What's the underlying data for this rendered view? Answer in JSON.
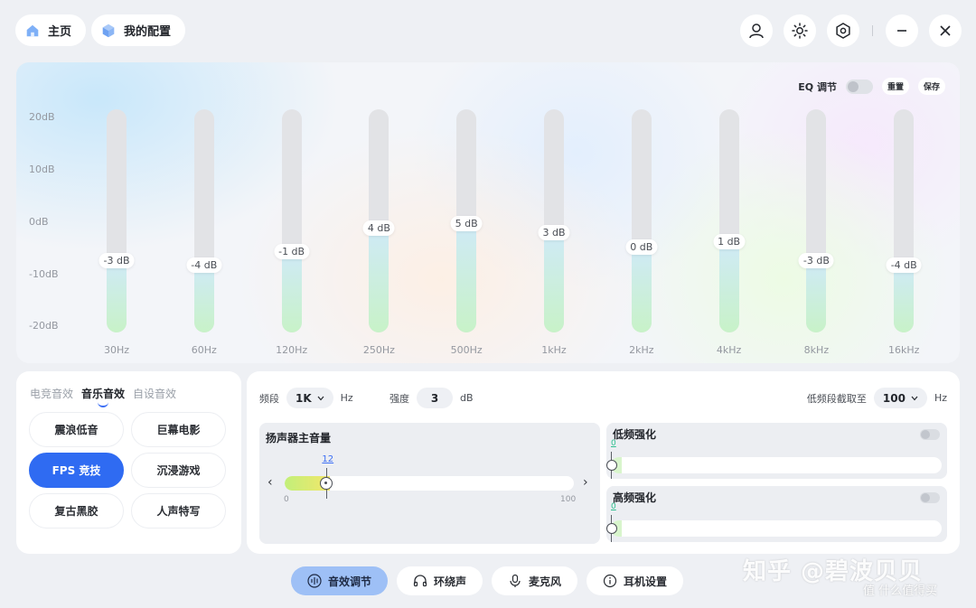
{
  "nav": {
    "home_label": "主页",
    "config_label": "我的配置"
  },
  "top_actions": [
    "user-icon",
    "brightness-icon",
    "settings-icon",
    "minimize-icon",
    "close-icon"
  ],
  "eq": {
    "toggle_label": "EQ 调节",
    "enabled": false,
    "reset_label": "重置",
    "save_label": "保存",
    "y_ticks": [
      "20dB",
      "10dB",
      "0dB",
      "-10dB",
      "-20dB"
    ],
    "range": [
      -20,
      20
    ],
    "bands": [
      {
        "freq": "30Hz",
        "gain": -3,
        "gain_label": "-3 dB"
      },
      {
        "freq": "60Hz",
        "gain": -4,
        "gain_label": "-4 dB"
      },
      {
        "freq": "120Hz",
        "gain": -1,
        "gain_label": "-1 dB"
      },
      {
        "freq": "250Hz",
        "gain": 4,
        "gain_label": "4 dB"
      },
      {
        "freq": "500Hz",
        "gain": 5,
        "gain_label": "5 dB"
      },
      {
        "freq": "1kHz",
        "gain": 3,
        "gain_label": "3 dB"
      },
      {
        "freq": "2kHz",
        "gain": 0,
        "gain_label": "0 dB"
      },
      {
        "freq": "4kHz",
        "gain": 1,
        "gain_label": "1 dB"
      },
      {
        "freq": "8kHz",
        "gain": -3,
        "gain_label": "-3 dB"
      },
      {
        "freq": "16kHz",
        "gain": -4,
        "gain_label": "-4 dB"
      }
    ]
  },
  "presets": {
    "tabs": [
      "电竞音效",
      "音乐音效",
      "自设音效"
    ],
    "active_tab": 1,
    "items": [
      "震浪低音",
      "巨幕电影",
      "FPS 竞技",
      "沉浸游戏",
      "复古黑胶",
      "人声特写"
    ],
    "selected": 2
  },
  "controls": {
    "band_label": "频段",
    "band_value": "1K",
    "band_unit": "Hz",
    "strength_label": "强度",
    "strength_value": "3",
    "strength_unit": "dB",
    "lowcut_label": "低频段截取至",
    "lowcut_value": "100",
    "lowcut_unit": "Hz",
    "volume": {
      "title": "扬声器主音量",
      "value": 12,
      "value_label": "12",
      "min_label": "0",
      "max_label": "100"
    },
    "bass_boost": {
      "title": "低频强化",
      "value": 0,
      "value_label": "0",
      "enabled": false
    },
    "treble_boost": {
      "title": "高频强化",
      "value": 0,
      "value_label": "0",
      "enabled": false
    }
  },
  "bottom_tabs": [
    {
      "label": "音效调节",
      "icon": "sound-wave-icon",
      "active": true
    },
    {
      "label": "环绕声",
      "icon": "headphones-icon",
      "active": false
    },
    {
      "label": "麦克风",
      "icon": "microphone-icon",
      "active": false
    },
    {
      "label": "耳机设置",
      "icon": "info-icon",
      "active": false
    }
  ],
  "watermark": {
    "main": "知乎 @碧波贝贝",
    "sub": "值 什么值得买"
  }
}
